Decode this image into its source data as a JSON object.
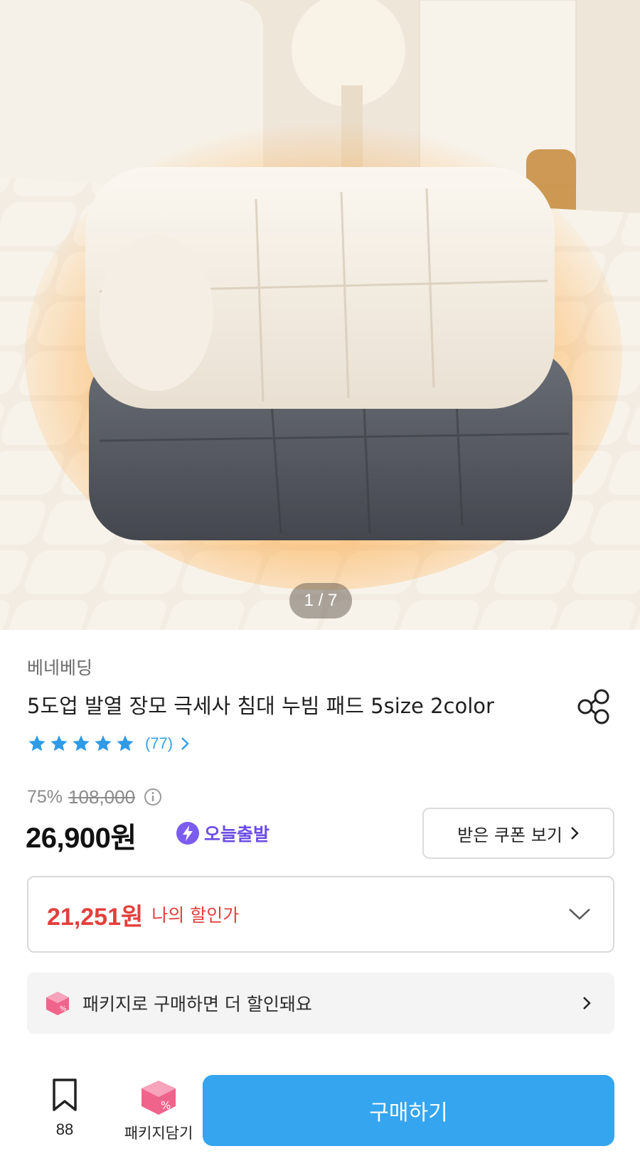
{
  "gallery": {
    "counter": "1 / 7",
    "image_alt": "Folded cream and charcoal quilted heated bed pads on a quilted mattress"
  },
  "product": {
    "brand": "베네베딩",
    "title": "5도업 발열 장모 극세사 침대 누빔 패드 5size 2color",
    "rating": {
      "stars": 5,
      "review_count": "(77)"
    },
    "discount_rate": "75%",
    "original_price": "108,000",
    "price": "26,900원",
    "today_ship_label": "오늘출발"
  },
  "coupon": {
    "label": "받은 쿠폰 보기"
  },
  "my_discount": {
    "price": "21,251원",
    "label": "나의 할인가"
  },
  "package_banner": {
    "text": "패키지로 구매하면 더 할인돼요"
  },
  "bottom_bar": {
    "bookmark_count": "88",
    "package_cart_label": "패키지담기",
    "buy_label": "구매하기"
  },
  "colors": {
    "accent_blue": "#35a5ef",
    "star_blue": "#2f9ae6",
    "sale_red": "#e2403d",
    "today_purple": "#6c4ce6",
    "package_pink": "#f0648c"
  }
}
